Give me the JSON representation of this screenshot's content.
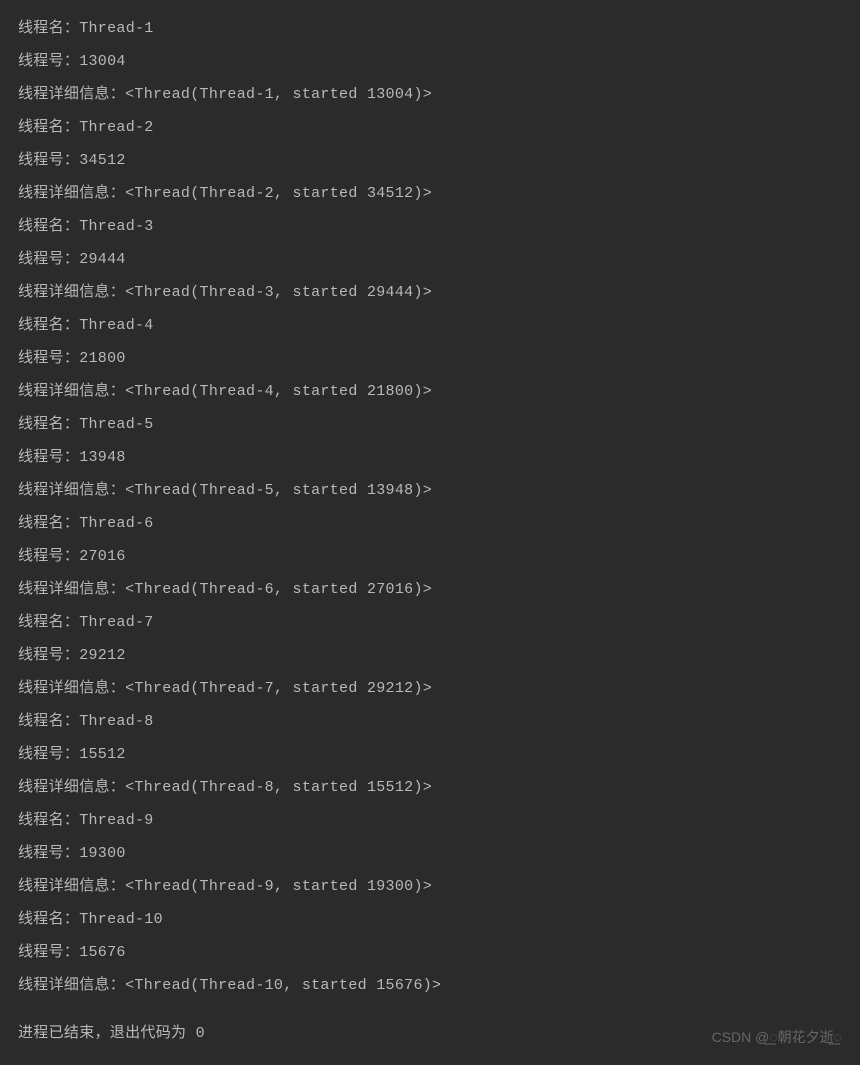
{
  "labels": {
    "thread_name": "线程名：",
    "thread_id": "线程号：",
    "thread_detail": "线程详细信息：",
    "exit_message": "进程已结束，退出代码为 0"
  },
  "threads": [
    {
      "name": "Thread-1",
      "id": "13004",
      "detail": "<Thread(Thread-1, started 13004)>"
    },
    {
      "name": "Thread-2",
      "id": "34512",
      "detail": "<Thread(Thread-2, started 34512)>"
    },
    {
      "name": "Thread-3",
      "id": "29444",
      "detail": "<Thread(Thread-3, started 29444)>"
    },
    {
      "name": "Thread-4",
      "id": "21800",
      "detail": "<Thread(Thread-4, started 21800)>"
    },
    {
      "name": "Thread-5",
      "id": "13948",
      "detail": "<Thread(Thread-5, started 13948)>"
    },
    {
      "name": "Thread-6",
      "id": "27016",
      "detail": "<Thread(Thread-6, started 27016)>"
    },
    {
      "name": "Thread-7",
      "id": "29212",
      "detail": "<Thread(Thread-7, started 29212)>"
    },
    {
      "name": "Thread-8",
      "id": "15512",
      "detail": "<Thread(Thread-8, started 15512)>"
    },
    {
      "name": "Thread-9",
      "id": "19300",
      "detail": "<Thread(Thread-9, started 19300)>"
    },
    {
      "name": "Thread-10",
      "id": "15676",
      "detail": "<Thread(Thread-10, started 15676)>"
    }
  ],
  "watermark": "CSDN @꯭朝花夕逝꯭"
}
